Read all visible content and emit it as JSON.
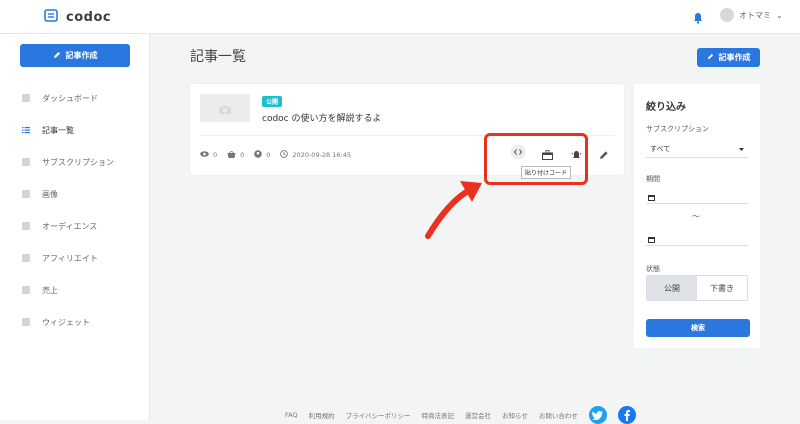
{
  "header": {
    "logo": "codoc",
    "user_name": "オトマミ",
    "user_chevron": "⌄"
  },
  "sidebar": {
    "create_label": "記事作成",
    "items": [
      {
        "label": "ダッシュボード",
        "icon": "dashboard-icon"
      },
      {
        "label": "記事一覧",
        "icon": "list-icon"
      },
      {
        "label": "サブスクリプション",
        "icon": "subscription-icon"
      },
      {
        "label": "画像",
        "icon": "image-icon"
      },
      {
        "label": "オーディエンス",
        "icon": "audience-icon"
      },
      {
        "label": "アフィリエイト",
        "icon": "affiliate-icon"
      },
      {
        "label": "売上",
        "icon": "sales-icon"
      },
      {
        "label": "ウィジェット",
        "icon": "widget-icon"
      }
    ]
  },
  "main": {
    "title": "記事一覧",
    "create_label": "記事作成",
    "article": {
      "badge": "公開",
      "title": "codoc の使い方を解説するよ",
      "views": "0",
      "purchases": "0",
      "subscribers": "0",
      "date": "2020-09-28 16:45",
      "tooltip": "貼り付けコード"
    }
  },
  "filter": {
    "title": "絞り込み",
    "subscription_label": "サブスクリプション",
    "subscription_value": "すべて",
    "period_label": "期間",
    "tilde": "〜",
    "status_label": "状態",
    "status_options": [
      "公開",
      "下書き"
    ],
    "search_label": "検索"
  },
  "footer": {
    "links": [
      "FAQ",
      "利用規約",
      "プライバシーポリシー",
      "特商法表記",
      "運営会社",
      "お知らせ",
      "お問い合わせ"
    ]
  },
  "colors": {
    "accent": "#2b77e0",
    "badge": "#1ebfcf",
    "highlight": "#e8321f",
    "twitter": "#1da1f2",
    "facebook": "#1877f2"
  }
}
